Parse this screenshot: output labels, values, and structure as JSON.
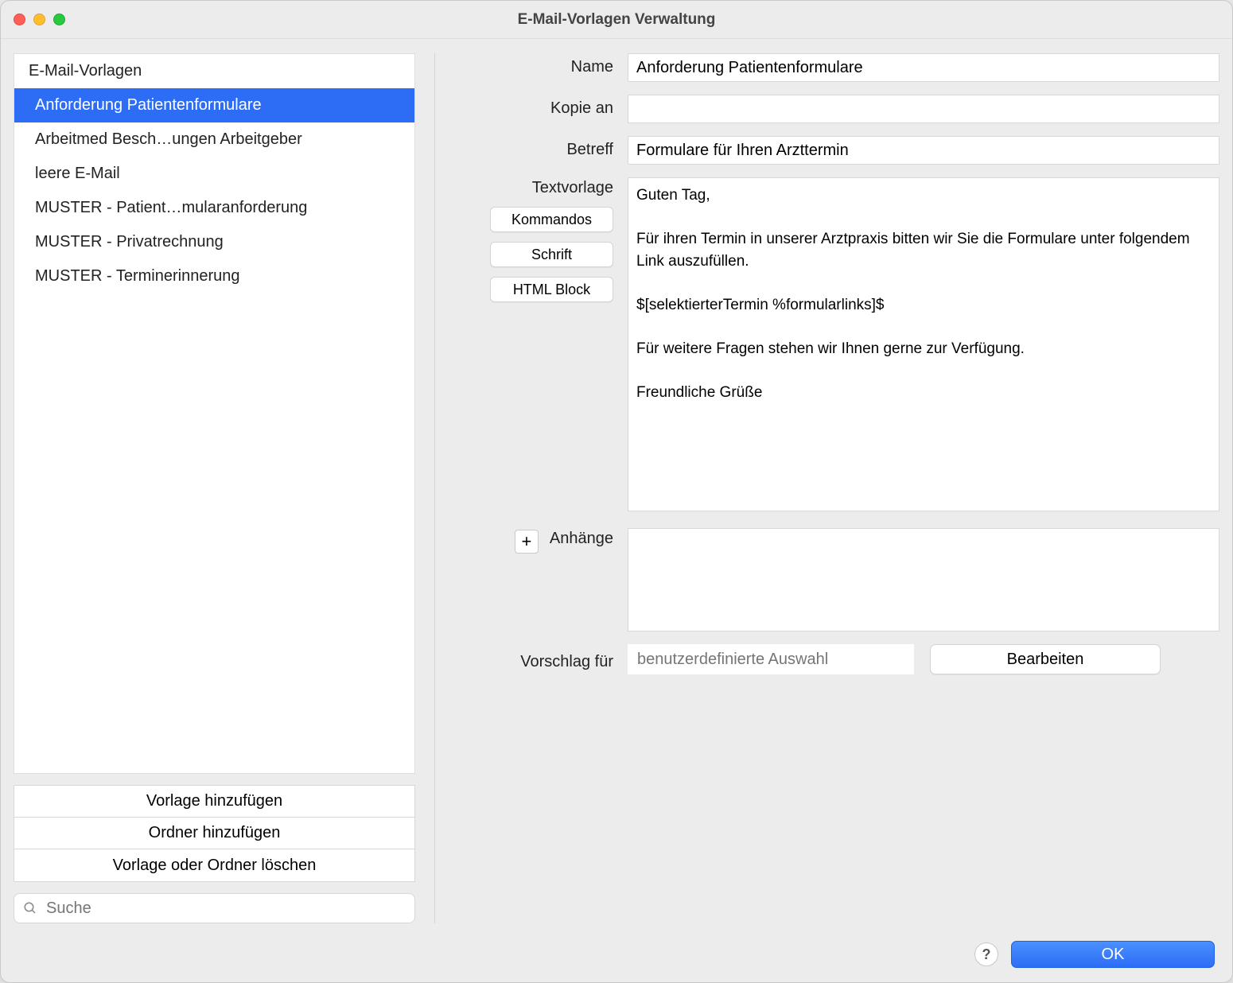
{
  "window": {
    "title": "E-Mail-Vorlagen Verwaltung"
  },
  "sidebar": {
    "header": "E-Mail-Vorlagen",
    "items": [
      {
        "label": "Anforderung Patientenformulare",
        "selected": true
      },
      {
        "label": "Arbeitmed Besch…ungen Arbeitgeber",
        "selected": false
      },
      {
        "label": "leere E-Mail",
        "selected": false
      },
      {
        "label": "MUSTER - Patient…mularanforderung",
        "selected": false
      },
      {
        "label": "MUSTER - Privatrechnung",
        "selected": false
      },
      {
        "label": "MUSTER - Terminerinnerung",
        "selected": false
      }
    ],
    "buttons": {
      "add_template": "Vorlage hinzufügen",
      "add_folder": "Ordner hinzufügen",
      "delete": "Vorlage oder Ordner löschen"
    },
    "search_placeholder": "Suche"
  },
  "form": {
    "labels": {
      "name": "Name",
      "cc": "Kopie an",
      "subject": "Betreff",
      "body": "Textvorlage",
      "attachments": "Anhänge",
      "suggestion": "Vorschlag für"
    },
    "fields": {
      "name": "Anforderung Patientenformulare",
      "cc": "",
      "subject": "Formulare für Ihren Arzttermin",
      "body": "Guten Tag,\n\nFür ihren Termin in unserer Arztpraxis bitten wir Sie die Formulare unter folgendem Link auszufüllen.\n\n$[selektierterTermin %formularlinks]$\n\nFür weitere Fragen stehen wir Ihnen gerne zur Verfügung.\n\nFreundliche Grüße"
    },
    "body_buttons": {
      "commands": "Kommandos",
      "font": "Schrift",
      "html_block": "HTML Block"
    },
    "suggestion_placeholder": "benutzerdefinierte Auswahl",
    "edit_button": "Bearbeiten"
  },
  "footer": {
    "help": "?",
    "ok": "OK"
  }
}
